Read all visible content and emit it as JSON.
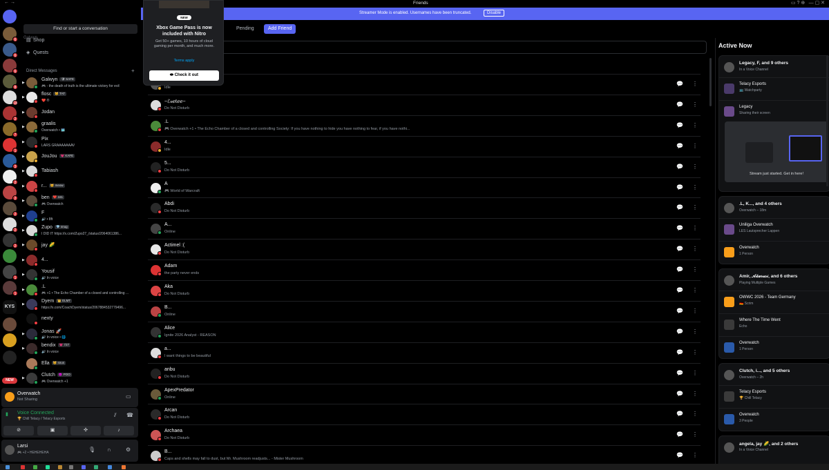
{
  "titlebar": {
    "title": "Friends",
    "nav": "←  →",
    "icons": "▭  ?  ⊕",
    "window_buttons": "—  ▢  ✕"
  },
  "banner": {
    "message": "Streamer Mode is enabled. Usernames have been truncated.",
    "disable": "Disable"
  },
  "popup": {
    "badge": "NEW",
    "heading": "Xbox Game Pass is now included with Nitro",
    "body": "Get 50+ games, 10 hours of cloud gaming per month, and much more.",
    "terms": "Terms apply",
    "button": "Check it out"
  },
  "sidebar": {
    "search_placeholder": "Find or start a conversation",
    "ghost_name": "Galwyn",
    "nav": [
      {
        "label": "Shop",
        "icon": "shop-icon"
      },
      {
        "label": "Quests",
        "icon": "quests-icon"
      }
    ],
    "dm_header": "Direct Messages",
    "dms": [
      {
        "name": "Galwyn",
        "tag": "🛡 SAFE",
        "sub": "🎮 - the death of truth is the ultimate victory for evil",
        "color": "#7a5c3a",
        "status": "#23a55a",
        "caret": true
      },
      {
        "name": "flosc",
        "tag": "🐱 TAT",
        "sub": "❤️ ®",
        "color": "#e8e8e8",
        "status": "#f23f43",
        "caret": true
      },
      {
        "name": "Jodan",
        "tag": "",
        "sub": "",
        "color": "#6b3b2e",
        "status": "#f23f43",
        "caret": true
      },
      {
        "name": "graalis",
        "tag": "",
        "sub": "Overwatch • 🗺️",
        "color": "#8b6a3a",
        "status": "#23a55a",
        "caret": true
      },
      {
        "name": "Pix",
        "tag": "",
        "sub": "LARS GRAAAAAAAV",
        "color": "#2a2a2a",
        "status": "#f23f43",
        "caret": true
      },
      {
        "name": "JouJou",
        "tag": "💗 KAFE",
        "sub": "",
        "color": "#c9a24a",
        "status": "#f0b232",
        "caret": true
      },
      {
        "name": "Tabiash",
        "tag": "",
        "sub": "",
        "color": "#d9d9d9",
        "status": "#f23f43",
        "caret": true
      },
      {
        "name": "r...",
        "tag": "🐱 meow",
        "sub": "",
        "color": "#c44",
        "status": "#f23f43",
        "caret": true
      },
      {
        "name": "ben",
        "tag": "❤️ 161",
        "sub": "🎮 Overwatch",
        "color": "#5a4a3a",
        "status": "#23a55a",
        "caret": true
      },
      {
        "name": "F",
        "tag": "",
        "sub": "🔊 • 8ft",
        "color": "#1f3f8f",
        "status": "#23a55a",
        "caret": true
      },
      {
        "name": "Zupo",
        "tag": "💎 snug",
        "sub": "I DID IT https://x.com/Zupo27_/status/2064061386...",
        "color": "#d8d8d8",
        "status": "#23a55a",
        "caret": true
      },
      {
        "name": "jay 🌽",
        "tag": "",
        "sub": "",
        "color": "#6a4a2a",
        "status": "#f23f43",
        "caret": true
      },
      {
        "name": "4...",
        "tag": "",
        "sub": "",
        "color": "#8b2b2b",
        "status": "#f23f43",
        "caret": true
      },
      {
        "name": "Yousif",
        "tag": "",
        "sub": "🔊 In voice",
        "color": "#333",
        "status": "#23a55a",
        "caret": true
      },
      {
        "name": ".L",
        "tag": "",
        "sub": "🎮 +1 • The Echo Chamber of a closed and controlling ...",
        "color": "#4a8a3a",
        "status": "#f23f43",
        "caret": true
      },
      {
        "name": "Dyem",
        "tag": "👑 ELMT",
        "sub": "https://x.com/CoachDyem/status/2067884532779496...",
        "color": "#3a3a5a",
        "status": "#f23f43",
        "caret": true
      },
      {
        "name": "nexty",
        "tag": "",
        "sub": "",
        "color": "#111",
        "status": "#f23f43",
        "caret": false
      },
      {
        "name": "Jonas 🚀",
        "tag": "",
        "sub": "🔊 In voice • 🌐",
        "color": "#2a2a3a",
        "status": "#23a55a",
        "caret": true
      },
      {
        "name": "bendix",
        "tag": "💗 727",
        "sub": "🔊 In voice",
        "color": "#3a2a2a",
        "status": "#23a55a",
        "caret": true
      },
      {
        "name": "Ella",
        "tag": "🐱 snus",
        "sub": "",
        "color": "#aa7a5a",
        "status": "#23a55a",
        "caret": false
      },
      {
        "name": "Clutch",
        "tag": "😈 POO",
        "sub": "🎮 Overwatch +1",
        "color": "#3a3a3a",
        "status": "#23a55a",
        "caret": true
      }
    ]
  },
  "activity_panel": {
    "game": "Overwatch",
    "status": "Not Sharing"
  },
  "voice_panel": {
    "title": "Voice Connected",
    "channel": "🏆 Chill Telacy / Telacy Esports"
  },
  "user_panel": {
    "name": "Larsi",
    "status": "🎮 +2 • HEHEHEHA"
  },
  "tabs": [
    {
      "label": "Pending"
    },
    {
      "label": "Add Friend"
    }
  ],
  "friends": [
    {
      "name": "",
      "sub": "Idle",
      "color": "#555",
      "status": "#f0b232"
    },
    {
      "name": "~ℰ𝓋ℯℓℯℯ~",
      "sub": "Do Not Disturb",
      "color": "#ddd",
      "status": "#f23f43"
    },
    {
      "name": ".L",
      "sub": "🎮 Overwatch +1 • The Echo Chamber of a closed and controlling Society: If you have nothing to hide you have nothing to fear, if you have nothi...",
      "color": "#4a8a3a",
      "status": "#f23f43"
    },
    {
      "name": "4...",
      "sub": "Idle",
      "color": "#8b2b2b",
      "status": "#f0b232"
    },
    {
      "name": "5...",
      "sub": "Do Not Disturb",
      "color": "#222",
      "status": "#f23f43"
    },
    {
      "name": "A",
      "sub": "🎮 World of Warcraft",
      "color": "#eee",
      "status": "#23a55a"
    },
    {
      "name": "Abdi",
      "sub": "Do Not Disturb",
      "color": "#2a2a2a",
      "status": "#f23f43"
    },
    {
      "name": "A...",
      "sub": "Online",
      "color": "#444",
      "status": "#23a55a"
    },
    {
      "name": "Actimel :(",
      "sub": "Do Not Disturb",
      "color": "#e8e8e8",
      "status": "#f23f43"
    },
    {
      "name": "Adam",
      "sub": "the party never ends",
      "color": "#d33",
      "status": "#f23f43"
    },
    {
      "name": "Aka",
      "sub": "Do Not Disturb",
      "color": "#d44",
      "status": "#f23f43"
    },
    {
      "name": "B...",
      "sub": "Online",
      "color": "#b44",
      "status": "#23a55a"
    },
    {
      "name": "Alice",
      "sub": "Ignite 2026 Analyst - REASON",
      "color": "#333",
      "status": "#23a55a"
    },
    {
      "name": "a...",
      "sub": "I want things to be beautiful",
      "color": "#ddd",
      "status": "#f23f43"
    },
    {
      "name": "anbu",
      "sub": "Do Not Disturb",
      "color": "#222",
      "status": "#f23f43"
    },
    {
      "name": "ApexPredator",
      "sub": "Online",
      "color": "#6a5a3a",
      "status": "#23a55a"
    },
    {
      "name": "Arcan",
      "sub": "Do Not Disturb",
      "color": "#2a2a2a",
      "status": "#f23f43"
    },
    {
      "name": "Archaea",
      "sub": "Do Not Disturb",
      "color": "#c55",
      "status": "#f23f43"
    },
    {
      "name": "B...",
      "sub": "Caps and shells may fall to dust, but Mr. Mushroom readjusts... - Mister Mushroom",
      "color": "#ccc",
      "status": "#f23f43"
    }
  ],
  "active_now": {
    "heading": "Active Now",
    "cards": [
      {
        "title": "Legacy, F, and 9 others",
        "sub": "In a Voice Channel",
        "rows": [
          {
            "t": "Telacy Esports",
            "s": "📺 Watchparty"
          },
          {
            "t": "Legacy",
            "s": "Sharing their screen"
          }
        ],
        "stream": "Stream just started. Get in here!"
      },
      {
        "title": ".L, K..., and 4 others",
        "sub": "Overwatch – 18m",
        "rows": [
          {
            "t": "Uniliga Overwatch",
            "s": "LES Lautsprecher Lappen"
          },
          {
            "t": "Overwatch",
            "s": "1 Person"
          }
        ]
      },
      {
        "title": "Amir, 𝒜𝓀𝓊𝓇𝒶𝓈𝒾, and 6 others",
        "sub": "Playing Multiple Games",
        "rows": [
          {
            "t": "OWWC 2026 - Team Germany",
            "s": "🇩🇪 Scrim"
          },
          {
            "t": "Where The Time Went",
            "s": "Echo"
          },
          {
            "t": "Overwatch",
            "s": "1 Person"
          }
        ]
      },
      {
        "title": "Clutch, i..., and 5 others",
        "sub": "Overwatch – 2h",
        "rows": [
          {
            "t": "Telacy Esports",
            "s": "🏆 Chill Telacy"
          },
          {
            "t": "Overwatch",
            "s": "3 People"
          }
        ]
      },
      {
        "title": "angela, jay 🌽, and 2 others",
        "sub": "In a Voice Channel",
        "rows": []
      }
    ]
  },
  "kys_label": "KYS",
  "new_label": "NEW"
}
